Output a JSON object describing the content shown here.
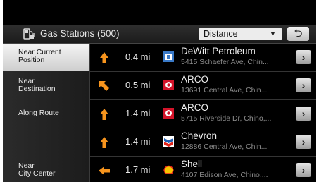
{
  "header": {
    "title": "Gas Stations (500)",
    "sort_value": "Distance",
    "sort_arrow": "▼",
    "back_glyph": "⮌",
    "title_icon": "gas-pump-icon"
  },
  "sidebar": {
    "items": [
      {
        "line1": "Near Current",
        "line2": "Position",
        "active": true
      },
      {
        "line1": "Near",
        "line2": "Destination",
        "active": false
      },
      {
        "line1": "Along Route",
        "line2": "",
        "active": false
      },
      {
        "line1": "Near",
        "line2": "City Center",
        "active": false
      }
    ]
  },
  "stations": [
    {
      "direction": "up",
      "distance": "0.4 mi",
      "brand_icon": "dewitt-logo-icon",
      "name": "DeWitt Petroleum",
      "address": "5415 Schaefer Ave, Chin..."
    },
    {
      "direction": "up-left",
      "distance": "0.5 mi",
      "brand_icon": "arco-logo-icon",
      "name": "ARCO",
      "address": "13691 Central Ave, Chin..."
    },
    {
      "direction": "up",
      "distance": "1.4 mi",
      "brand_icon": "arco-logo-icon",
      "name": "ARCO",
      "address": "5715 Riverside Dr, Chino,..."
    },
    {
      "direction": "up",
      "distance": "1.4 mi",
      "brand_icon": "chevron-logo-icon",
      "name": "Chevron",
      "address": "12886 Central Ave, Chin..."
    },
    {
      "direction": "left",
      "distance": "1.7 mi",
      "brand_icon": "shell-logo-icon",
      "name": "Shell",
      "address": "4107 Edison Ave, Chino,..."
    }
  ],
  "go_glyph": "›",
  "colors": {
    "arrow": "#f7941d",
    "arco": "#d4142a",
    "chevron_blue": "#1f5fb4",
    "shell_yellow": "#f6c400",
    "shell_red": "#e2231a",
    "dewitt_blue": "#3a7ac8"
  }
}
